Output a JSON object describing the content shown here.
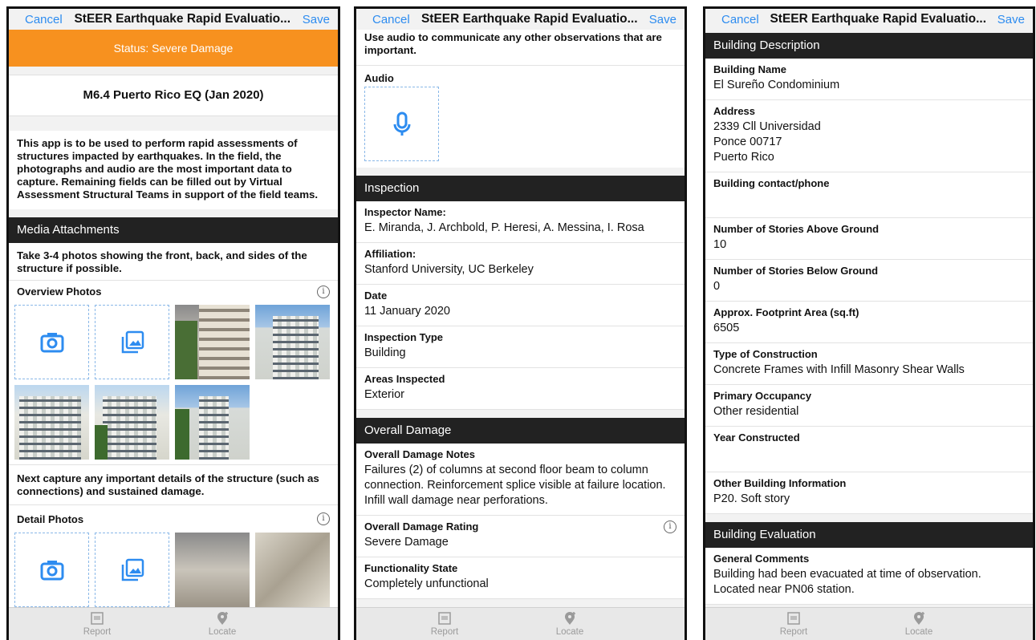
{
  "nav": {
    "cancel": "Cancel",
    "title": "StEER Earthquake Rapid Evaluatio...",
    "save": "Save"
  },
  "tabs": {
    "report": "Report",
    "locate": "Locate"
  },
  "colors": {
    "accent": "#2d8cf0",
    "status": "#f7911f",
    "header": "#222222"
  },
  "panel1": {
    "status": "Status: Severe Damage",
    "event": "M6.4 Puerto Rico EQ (Jan 2020)",
    "intro": "This app is to be used to perform rapid assessments of structures impacted by earthquakes. In the field, the photographs and audio are the most important data to capture. Remaining fields can be filled out by Virtual Assessment Structural Teams in support of the field teams.",
    "media_header": "Media Attachments",
    "media_instructions": "Take 3-4 photos showing the front, back, and sides of the structure if possible.",
    "overview_label": "Overview Photos",
    "detail_instructions": "Next capture any important details of the structure (such as connections) and sustained damage.",
    "detail_label": "Detail Photos",
    "icons": [
      "camera-icon",
      "gallery-icon",
      "info-icon"
    ]
  },
  "panel2": {
    "audio_note": "Use audio to communicate any other observations that are important.",
    "audio_label": "Audio",
    "inspection_header": "Inspection",
    "inspector_label": "Inspector Name:",
    "inspector_value": "E. Miranda, J. Archbold, P. Heresi, A. Messina, I. Rosa",
    "affiliation_label": "Affiliation:",
    "affiliation_value": "Stanford University, UC Berkeley",
    "date_label": "Date",
    "date_value": "11 January 2020",
    "type_label": "Inspection Type",
    "type_value": "Building",
    "areas_label": "Areas Inspected",
    "areas_value": "Exterior",
    "damage_header": "Overall Damage",
    "notes_label": "Overall Damage Notes",
    "notes_value": "Failures (2) of columns at second floor beam to column connection. Reinforcement splice visible at failure location. Infill wall damage near perforations.",
    "rating_label": "Overall Damage Rating",
    "rating_value": "Severe Damage",
    "func_label": "Functionality State",
    "func_value": "Completely unfunctional"
  },
  "panel3": {
    "desc_header": "Building Description",
    "name_label": "Building Name",
    "name_value": "El Sureño Condominium",
    "address_label": "Address",
    "address_line1": "2339 Cll Universidad",
    "address_line2": "Ponce 00717",
    "address_line3": "Puerto Rico",
    "contact_label": "Building contact/phone",
    "contact_value": "",
    "above_label": "Number of Stories Above Ground",
    "above_value": "10",
    "below_label": "Number of Stories Below Ground",
    "below_value": "0",
    "area_label": "Approx. Footprint Area (sq.ft)",
    "area_value": "6505",
    "construction_label": "Type of Construction",
    "construction_value": "Concrete Frames with Infill Masonry Shear Walls",
    "occupancy_label": "Primary Occupancy",
    "occupancy_value": "Other residential",
    "year_label": "Year Constructed",
    "year_value": "",
    "other_label": "Other Building Information",
    "other_value": "P20.  Soft story",
    "eval_header": "Building Evaluation",
    "comments_label": "General Comments",
    "comments_value": "Building had been evacuated at time of observation. Located near PN06 station."
  }
}
